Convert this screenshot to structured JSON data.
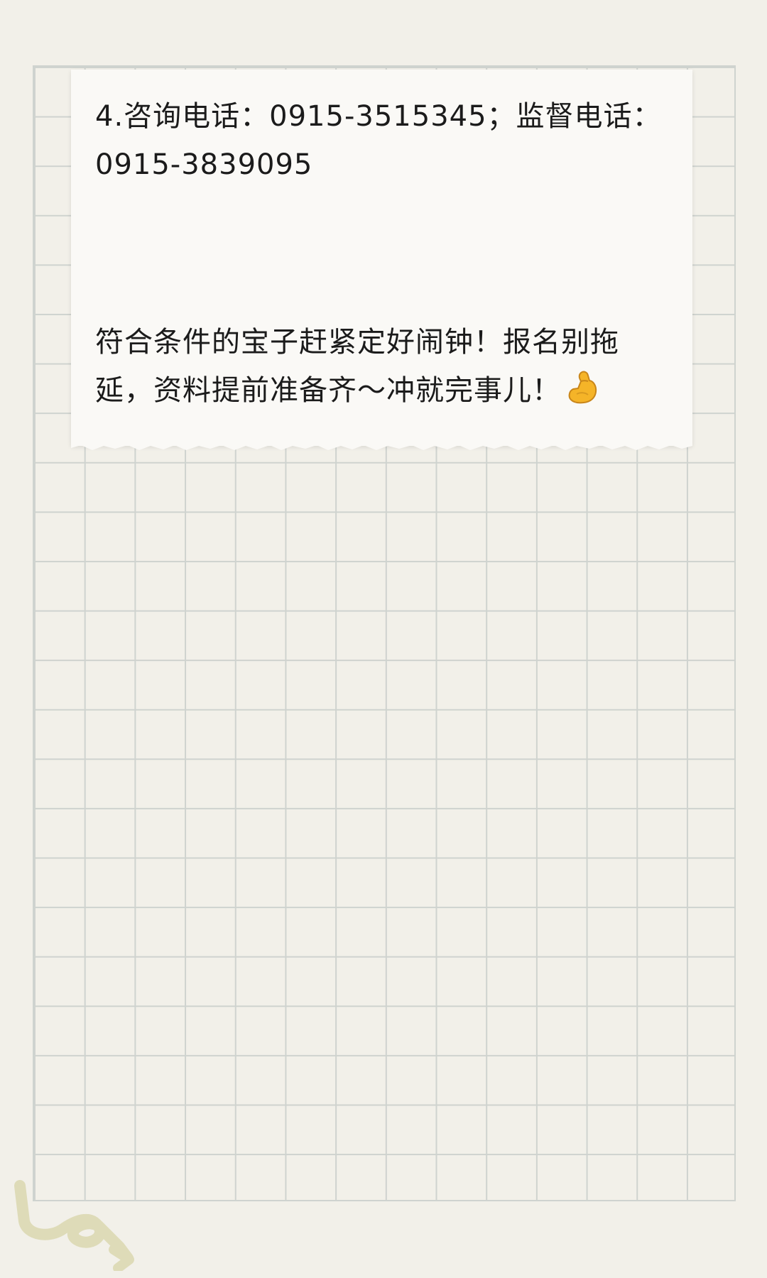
{
  "note": {
    "contact_line": "4.咨询电话：0915-3515345；监督电话：0915-3839095",
    "reminder_line": "符合条件的宝子赶紧定好闹钟！报名别拖延，资料提前准备齐～冲就完事儿！",
    "emoji": "flexed-biceps-emoji"
  },
  "colors": {
    "background": "#f2f0e9",
    "grid_line": "#cfd3cf",
    "card": "#faf9f6",
    "text": "#1b1b1b",
    "doodle": "#dedbb8"
  }
}
